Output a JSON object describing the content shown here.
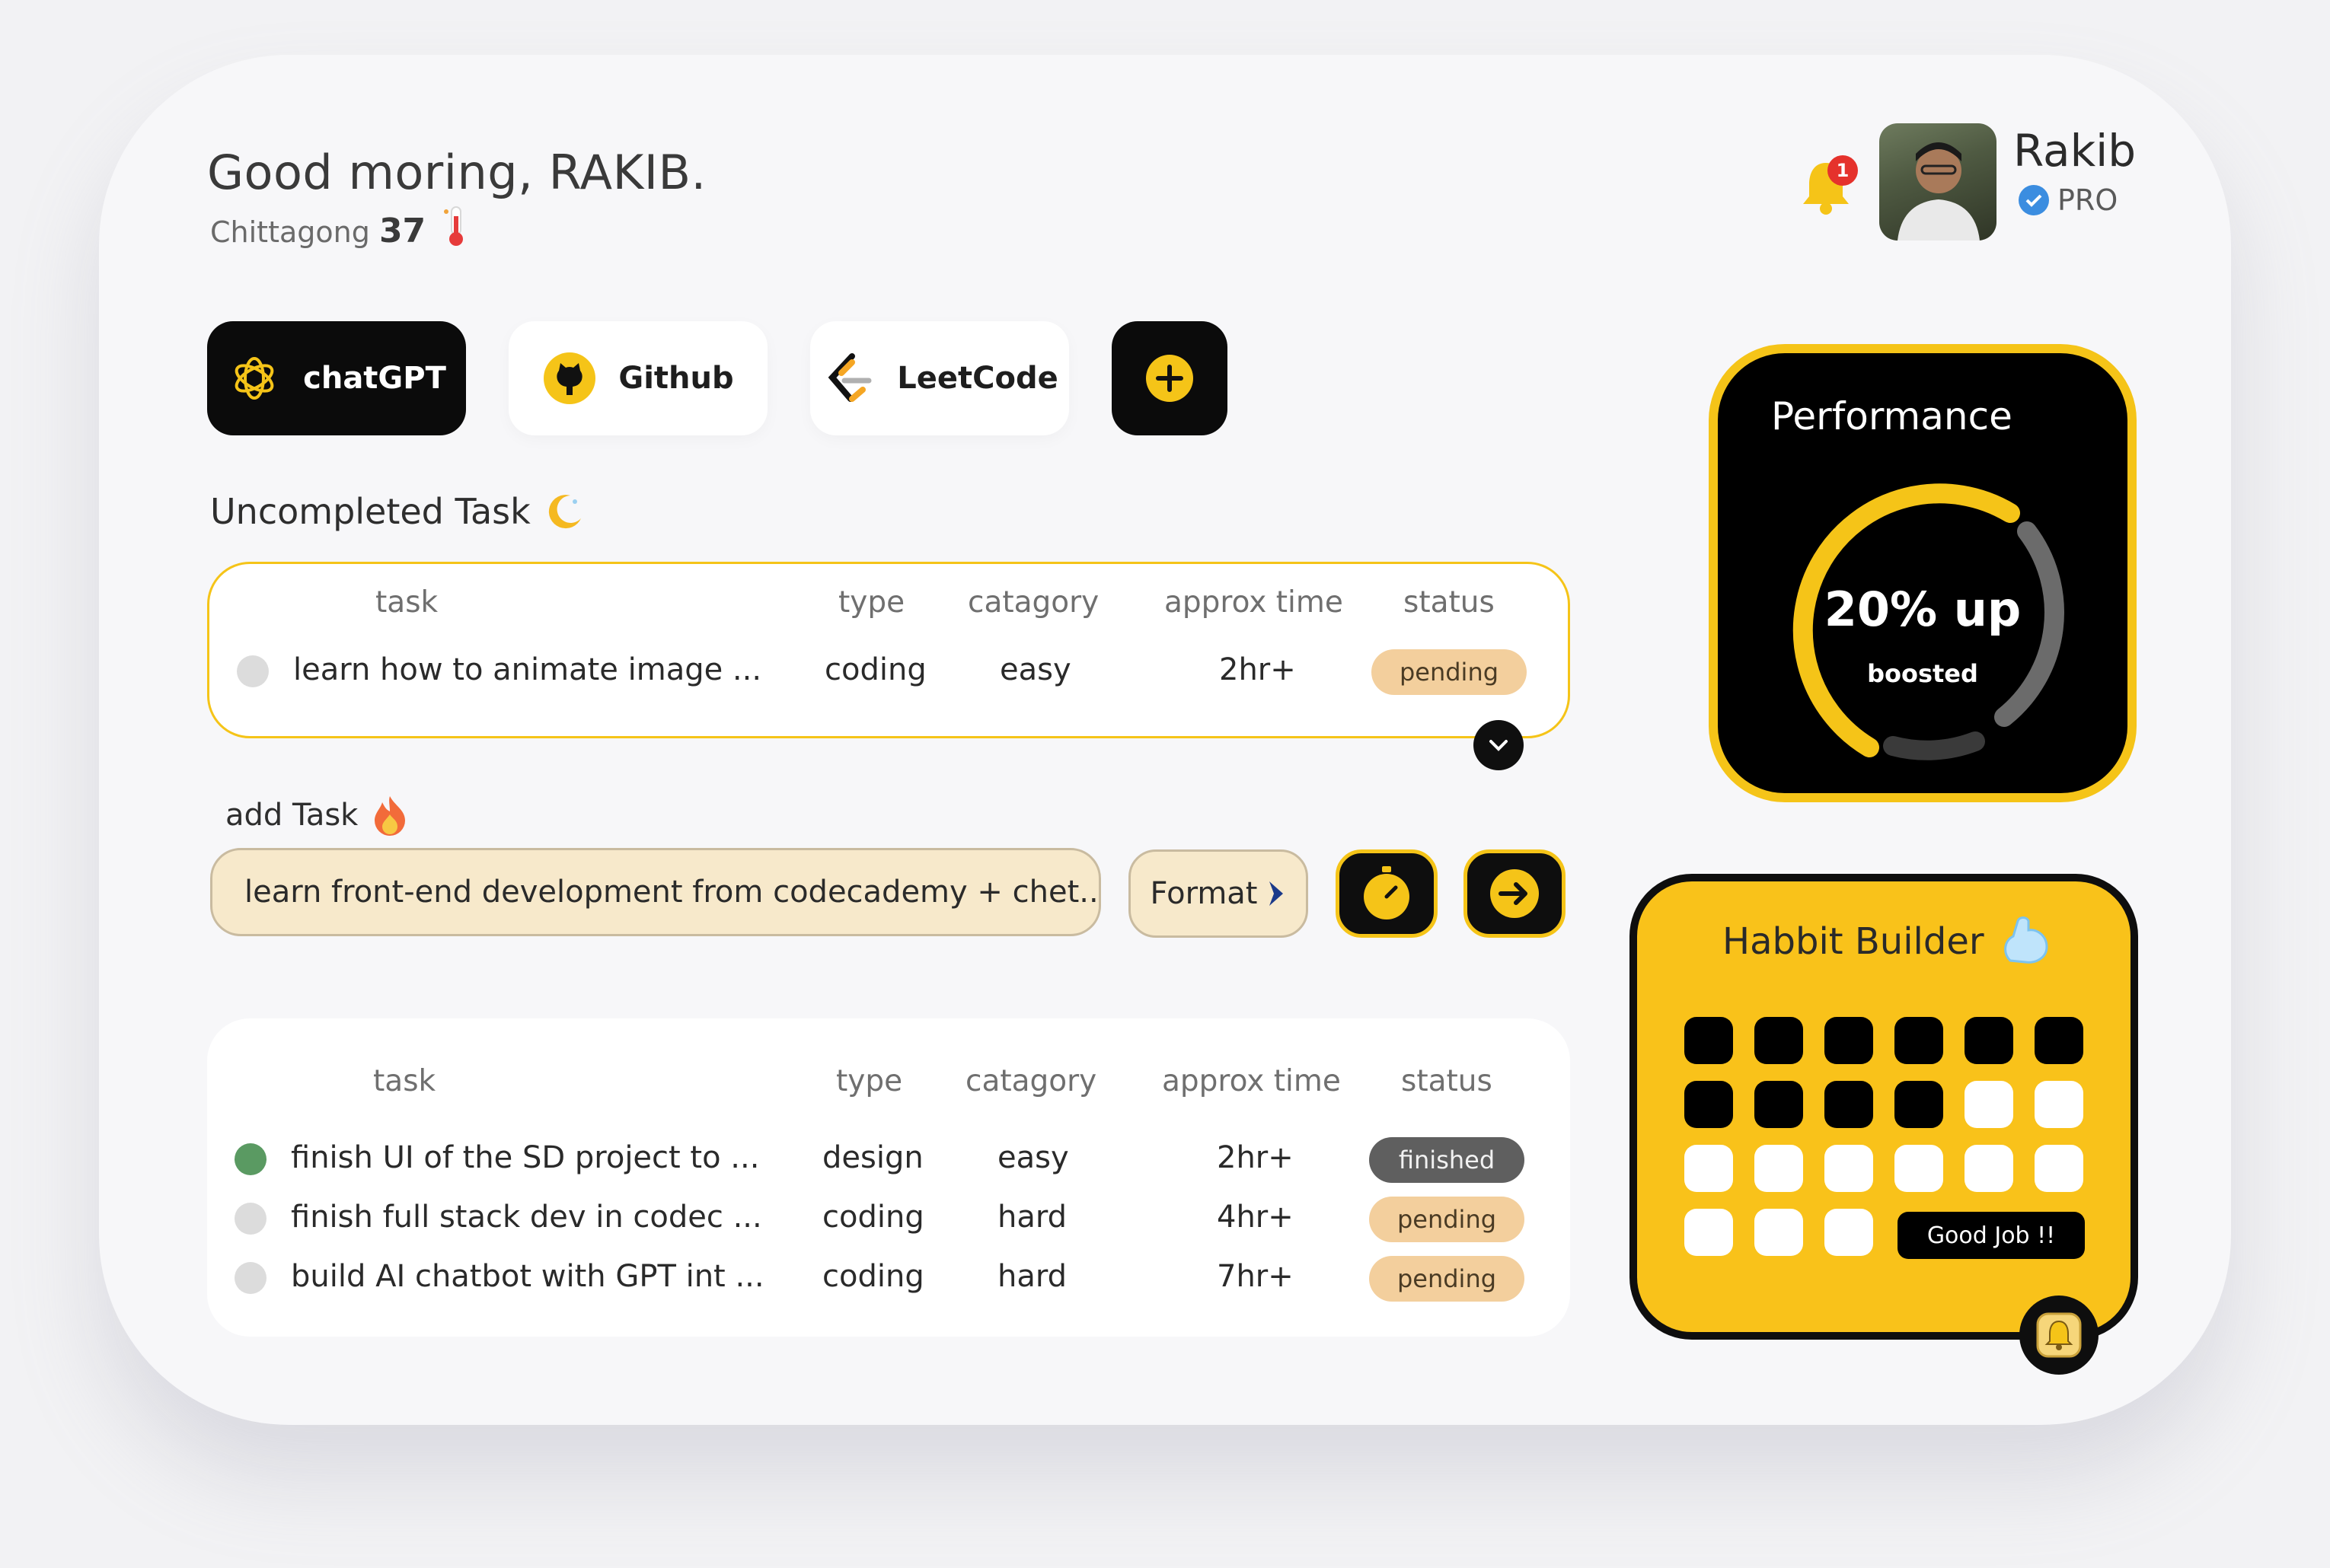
{
  "header": {
    "greeting": "Good moring, RAKIB.",
    "city": "Chittagong",
    "temperature": "37"
  },
  "profile": {
    "name": "Rakib",
    "badge": "PRO",
    "notification_count": "1"
  },
  "shortcuts": [
    {
      "label": "chatGPT",
      "icon": "openai-icon"
    },
    {
      "label": "Github",
      "icon": "github-icon"
    },
    {
      "label": "LeetCode",
      "icon": "leetcode-icon"
    },
    {
      "label": "",
      "icon": "plus-icon"
    }
  ],
  "uncompleted": {
    "title": "Uncompleted Task",
    "columns": [
      "task",
      "type",
      "catagory",
      "approx time",
      "status"
    ],
    "rows": [
      {
        "task": "learn how to animate image ...",
        "type": "coding",
        "category": "easy",
        "time": "2hr+",
        "status": "pending"
      }
    ]
  },
  "add_task": {
    "title": "add Task",
    "input_value": "learn front-end development from codecademy + chet...",
    "format_label": "Format"
  },
  "tasks": {
    "columns": [
      "task",
      "type",
      "catagory",
      "approx time",
      "status"
    ],
    "rows": [
      {
        "task": "finish UI of the SD project to ...",
        "type": "design",
        "category": "easy",
        "time": "2hr+",
        "status": "finished"
      },
      {
        "task": "finish full stack dev in codec ...",
        "type": "coding",
        "category": "hard",
        "time": "4hr+",
        "status": "pending"
      },
      {
        "task": "build AI chatbot with GPT int ...",
        "type": "coding",
        "category": "hard",
        "time": "7hr+",
        "status": "pending"
      }
    ]
  },
  "performance": {
    "title": "Performance",
    "value": "20% up",
    "label": "boosted"
  },
  "habit": {
    "title": "Habbit Builder",
    "completed_days": 10,
    "total_days": 21,
    "message": "Good Job !!"
  },
  "colors": {
    "accent": "#f5c418",
    "dark": "#0e0e0e",
    "pending": "#f3cf9d",
    "finished": "#5f5f5f",
    "done_dot": "#5a9a62"
  }
}
